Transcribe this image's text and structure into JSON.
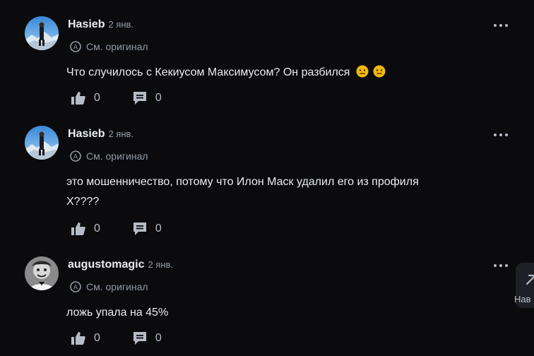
{
  "comments": [
    {
      "author": "Hasieb",
      "date": "2 янв.",
      "translate_label": "См. оригинал",
      "text": "Что случилось с Кекиусом Максимусом? Он разбился",
      "emoji": [
        "neutral-face-emoji",
        "neutral-face-emoji"
      ],
      "likes": "0",
      "replies": "0",
      "avatar": "mountain-person-avatar"
    },
    {
      "author": "Hasieb",
      "date": "2 янв.",
      "translate_label": "См. оригинал",
      "text": "это мошенничество, потому что Илон Маск удалил его из профиля X????",
      "likes": "0",
      "replies": "0",
      "avatar": "mountain-person-avatar"
    },
    {
      "author": "augustomagic",
      "date": "2 янв.",
      "translate_label": "См. оригинал",
      "text": "ложь упала на 45%",
      "likes": "0",
      "replies": "0",
      "avatar": "bw-portrait-avatar"
    }
  ],
  "nav_widget": {
    "label": "Нав"
  },
  "colors": {
    "background": "#0b0b0d",
    "text_primary": "#eaecef",
    "text_secondary": "#929aa5",
    "icon": "#b7bdc6",
    "emoji": "#f0b90b"
  }
}
